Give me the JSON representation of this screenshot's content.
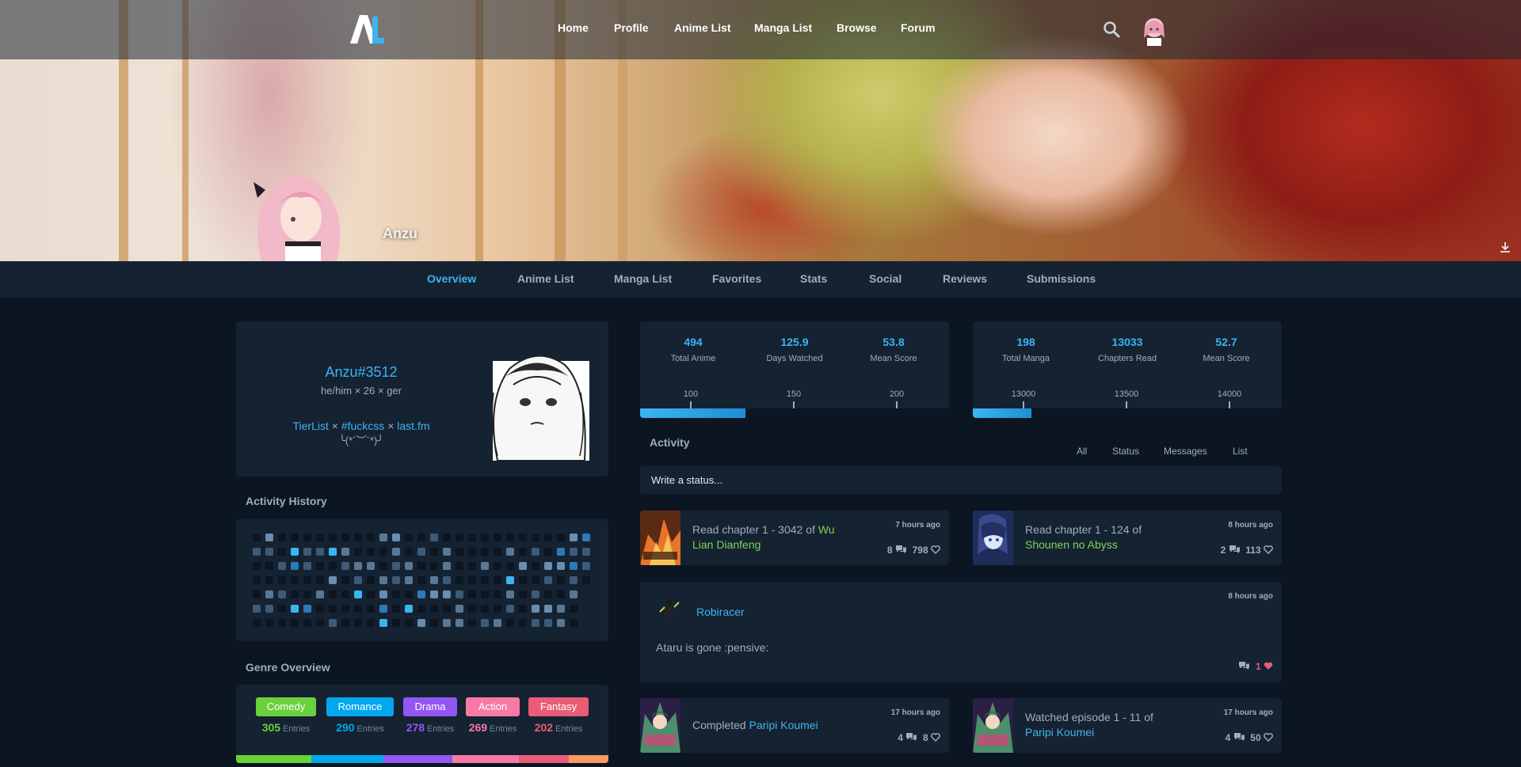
{
  "nav": {
    "logo_alt": "AL",
    "links": [
      "Home",
      "Profile",
      "Anime List",
      "Manga List",
      "Browse",
      "Forum"
    ]
  },
  "banner": {
    "username": "Anzu"
  },
  "profile_tabs": [
    "Overview",
    "Anime List",
    "Manga List",
    "Favorites",
    "Stats",
    "Social",
    "Reviews",
    "Submissions"
  ],
  "bio": {
    "name": "Anzu#3512",
    "subtitle": "he/him × 26 × ger",
    "links": [
      "TierList",
      "#fuckcss",
      "last.fm"
    ],
    "separator": " × ",
    "face": "╰(*´︶`*)╯"
  },
  "activity_history": {
    "title": "Activity History"
  },
  "genre_overview": {
    "title": "Genre Overview",
    "entries_label": "Entries",
    "genres": [
      {
        "name": "Comedy",
        "count": "305",
        "color": "#69d13c"
      },
      {
        "name": "Romance",
        "count": "290",
        "color": "#00a8ee"
      },
      {
        "name": "Drama",
        "count": "278",
        "color": "#9256f3"
      },
      {
        "name": "Action",
        "count": "269",
        "color": "#f779a4"
      },
      {
        "name": "Fantasy",
        "count": "202",
        "color": "#e85d75"
      }
    ],
    "bar_colors": [
      "#69d13c",
      "#00a8ee",
      "#9256f3",
      "#f779a4",
      "#e85d75",
      "#f79a63"
    ]
  },
  "anime_stats": {
    "total": "494",
    "total_label": "Total Anime",
    "days": "125.9",
    "days_label": "Days Watched",
    "mean": "53.8",
    "mean_label": "Mean Score",
    "ticks": [
      "100",
      "150",
      "200"
    ],
    "progress": 0.34
  },
  "manga_stats": {
    "total": "198",
    "total_label": "Total Manga",
    "chapters": "13033",
    "chapters_label": "Chapters Read",
    "mean": "52.7",
    "mean_label": "Mean Score",
    "ticks": [
      "13000",
      "13500",
      "14000"
    ],
    "progress": 0.19
  },
  "activity": {
    "title": "Activity",
    "filters": [
      "All",
      "Status",
      "Messages",
      "List"
    ],
    "status_placeholder": "Write a status...",
    "items": [
      {
        "prefix": "Read chapter 1 - 3042 of ",
        "title": "Wu Lian Dianfeng",
        "time": "7 hours ago",
        "replies": "8",
        "likes": "798"
      },
      {
        "prefix": "Read chapter 1 - 124 of ",
        "title": "Shounen no Abyss",
        "time": "8 hours ago",
        "replies": "2",
        "likes": "113"
      },
      {
        "prefix": "Completed ",
        "title": "Paripi Koumei",
        "time": "17 hours ago",
        "replies": "4",
        "likes": "8"
      },
      {
        "prefix": "Watched episode 1 - 11 of ",
        "title": "Paripi Koumei",
        "time": "17 hours ago",
        "replies": "4",
        "likes": "50"
      }
    ],
    "text_post": {
      "user": "Robiracer",
      "time": "8 hours ago",
      "text": "Ataru is gone :pensive:",
      "likes": "1"
    }
  }
}
